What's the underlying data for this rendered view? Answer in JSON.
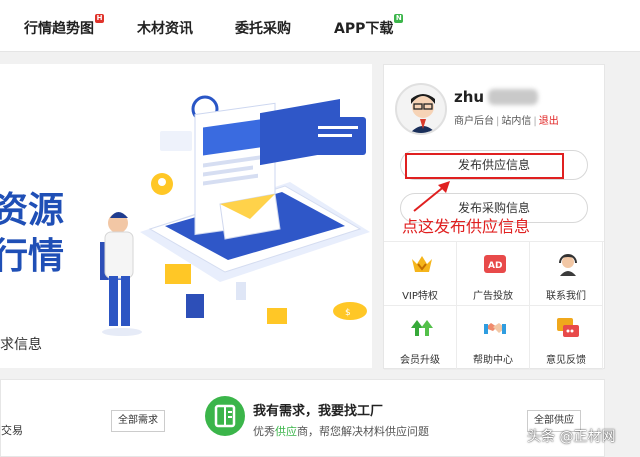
{
  "nav": {
    "items": [
      {
        "label": "行情趋势图",
        "badge": "H",
        "badge_color": "#e0332b"
      },
      {
        "label": "木材资讯"
      },
      {
        "label": "委托采购"
      },
      {
        "label": "APP下载",
        "badge": "N",
        "badge_color": "#3bb54a"
      }
    ]
  },
  "banner": {
    "big_line1": "资源",
    "big_line2": "行情",
    "small_text": "求信息"
  },
  "user": {
    "name": "zhu",
    "links": {
      "merchant": "商户后台",
      "inbox": "站内信",
      "logout": "退出"
    },
    "btn_supply": "发布供应信息",
    "btn_purchase": "发布采购信息",
    "annotation": "点这发布供应信息"
  },
  "quick": [
    {
      "label": "VIP特权",
      "icon": "vip-crown-icon"
    },
    {
      "label": "广告投放",
      "icon": "ad-icon"
    },
    {
      "label": "联系我们",
      "icon": "headset-icon"
    },
    {
      "label": "会员升级",
      "icon": "upgrade-arrows-icon"
    },
    {
      "label": "帮助中心",
      "icon": "handshake-icon"
    },
    {
      "label": "意见反馈",
      "icon": "feedback-icon"
    }
  ],
  "lower": {
    "left_text": "交易",
    "btn_all_demand": "全部需求",
    "title": "我有需求，我要找工厂",
    "sub_prefix": "优秀",
    "sub_highlight": "供应",
    "sub_suffix": "商，帮您解决材料供应问题",
    "btn_all_supply": "全部供应"
  },
  "watermark": "头条 @正材网",
  "colors": {
    "accent_blue": "#1f4fb6",
    "red": "#e02020",
    "green": "#3bb54a"
  }
}
